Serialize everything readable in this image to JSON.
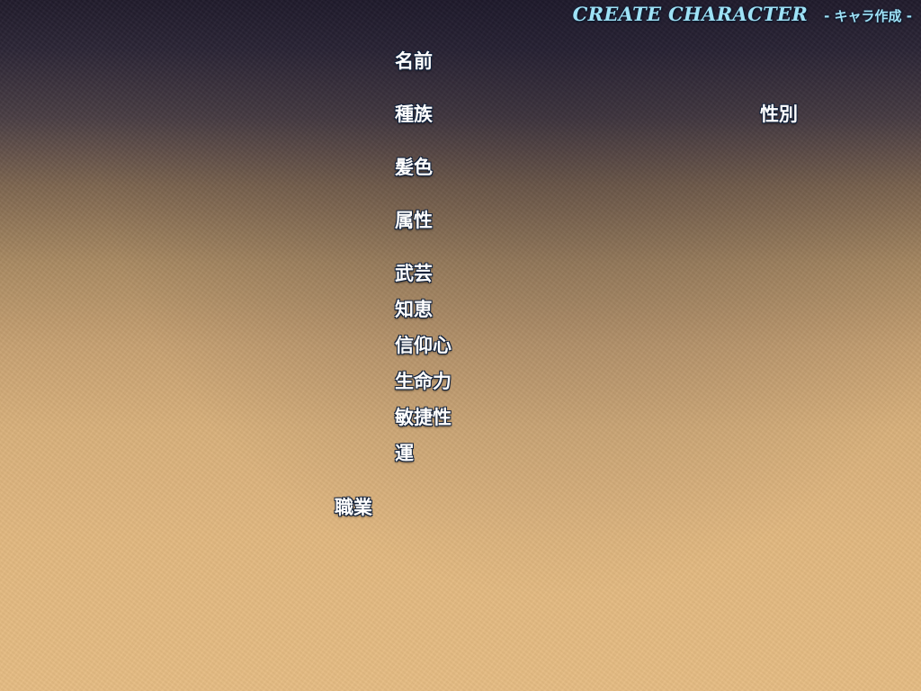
{
  "header": {
    "title": "CREATE CHARACTER",
    "subtitle": "- キャラ作成 -",
    "color": "#9ee2f6"
  },
  "fields": {
    "name": "名前",
    "race": "種族",
    "gender": "性別",
    "hair_color": "髪色",
    "element": "属性"
  },
  "stats": {
    "martial": "武芸",
    "wisdom": "知恵",
    "faith": "信仰心",
    "vitality": "生命力",
    "agility": "敏捷性",
    "luck": "運"
  },
  "class_label": "職業",
  "colors": {
    "label_text": "#ffffff",
    "label_outline": "#10203a",
    "bg_top": "#211c2c",
    "bg_bottom": "#e5bc83"
  }
}
